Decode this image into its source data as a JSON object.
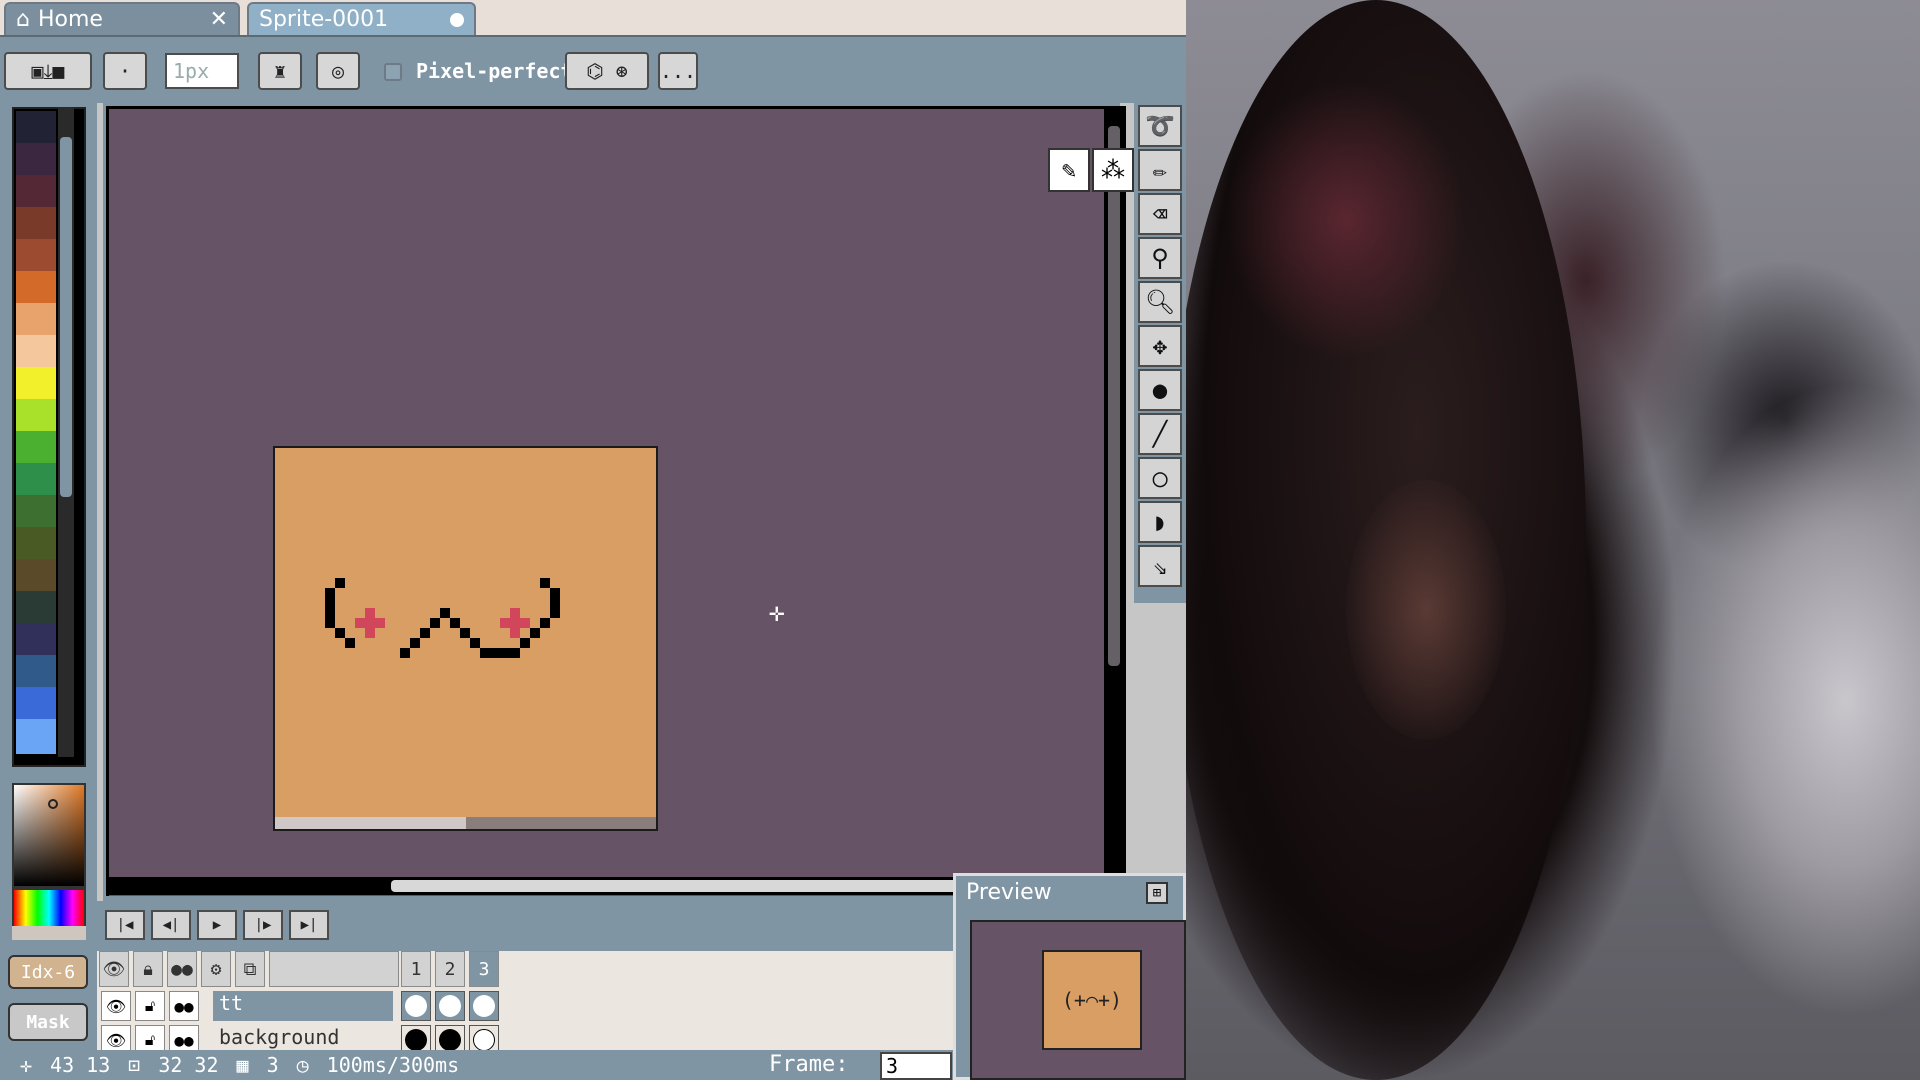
{
  "tabs": [
    {
      "label": "Home",
      "icon": "home-icon"
    },
    {
      "label": "Sprite-0001",
      "modified": true
    }
  ],
  "toolbar": {
    "brush_size": "1px",
    "pixel_perfect_label": "Pixel-perfect",
    "more_label": "..."
  },
  "left_panel": {
    "palette": [
      "#212234",
      "#3b2840",
      "#542834",
      "#7a3a2a",
      "#9c4a30",
      "#d46a2a",
      "#e7a36b",
      "#f4c89c",
      "#f2f02a",
      "#a9e02a",
      "#4bb030",
      "#2e8f4a",
      "#3d6f30",
      "#4a5a24",
      "#5a4a2a",
      "#2a3a34",
      "#30305a",
      "#2f5a8a",
      "#3a6ad8",
      "#6aa4f4"
    ],
    "index_button": "Idx-6",
    "mask_button": "Mask"
  },
  "layers": {
    "frame_headers": [
      "1",
      "2",
      "3"
    ],
    "rows": [
      {
        "name": "tt"
      },
      {
        "name": "background"
      }
    ]
  },
  "status": {
    "cursor_pos": "43  13",
    "sprite_size": "32  32",
    "frames": "3",
    "duration": "100ms/300ms",
    "frame_label": "Frame:",
    "frame_value": "3"
  },
  "preview": {
    "title": "Preview",
    "face": "(+⌒+)"
  },
  "colors": {
    "canvas_bg": "#665466",
    "sprite_fill": "#d99e64",
    "panel": "#7f95a4",
    "accent_pink": "#d2465c"
  }
}
